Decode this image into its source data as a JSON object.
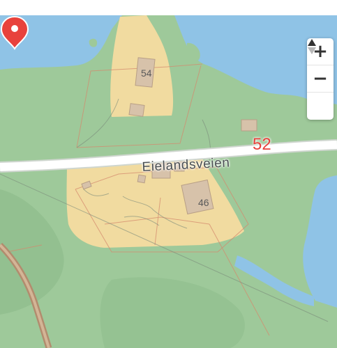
{
  "map": {
    "road_name": "Eielandsveien",
    "house_numbers": [
      "54",
      "46"
    ],
    "marker": {
      "label": "52",
      "color": "#e8423c"
    },
    "colors": {
      "water": "#8fc3e6",
      "forest": "#9ec99a",
      "residential": "#f1dba0",
      "building": "#d7c2aa",
      "road": "#ffffff",
      "rail": "#b28c6e",
      "property_line": "#d48a6e"
    }
  },
  "controls": {
    "zoom_in_label": "+",
    "zoom_out_label": "−",
    "compass_icon": "compass-icon"
  }
}
